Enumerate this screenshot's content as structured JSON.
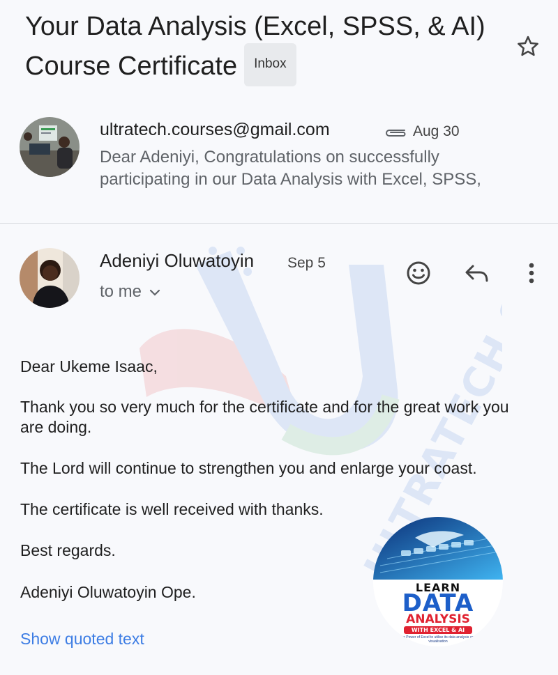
{
  "email": {
    "subject": "Your Data Analysis (Excel, SPSS, & AI) Course Certificate",
    "label": "Inbox"
  },
  "messages": [
    {
      "sender": "ultratech.courses@gmail.com",
      "date": "Aug 30",
      "snippet": "Dear Adeniyi, Congratulations on successfully participating in our Data Analysis with Excel, SPSS,",
      "has_attachment": true
    },
    {
      "sender": "Adeniyi Oluwatoyin",
      "date": "Sep 5",
      "recipient_text": "to me",
      "body": {
        "salutation": "Dear Ukeme Isaac,",
        "paragraph_1": "Thank you so very much for the certificate and for the great work you are doing.",
        "paragraph_2": "The Lord will continue to strengthen you and enlarge your coast.",
        "paragraph_3": "The certificate is well received with thanks.",
        "closing": "Best regards.",
        "signature": "Adeniyi Oluwatoyin Ope."
      },
      "show_quoted_label": "Show quoted text"
    }
  ],
  "icons": {
    "star": "star-outline-icon",
    "attachment": "paperclip-icon",
    "emoji": "smiley-icon",
    "reply": "reply-arrow-icon",
    "more": "vertical-dots-icon",
    "expand": "chevron-down-icon"
  },
  "overlay": {
    "watermark_text": "ULTRATECH SYSTEMS",
    "badge": {
      "line1": "LEARN",
      "line2": "DATA",
      "line3": "ANALYSIS",
      "line4": "WITH EXCEL & AI",
      "tagline": "the Power of Excel to utilise its data analysis and visualisation"
    }
  },
  "colors": {
    "link": "#3d7de4",
    "badge_blue": "#1d5fc9",
    "badge_red": "#e02231"
  }
}
